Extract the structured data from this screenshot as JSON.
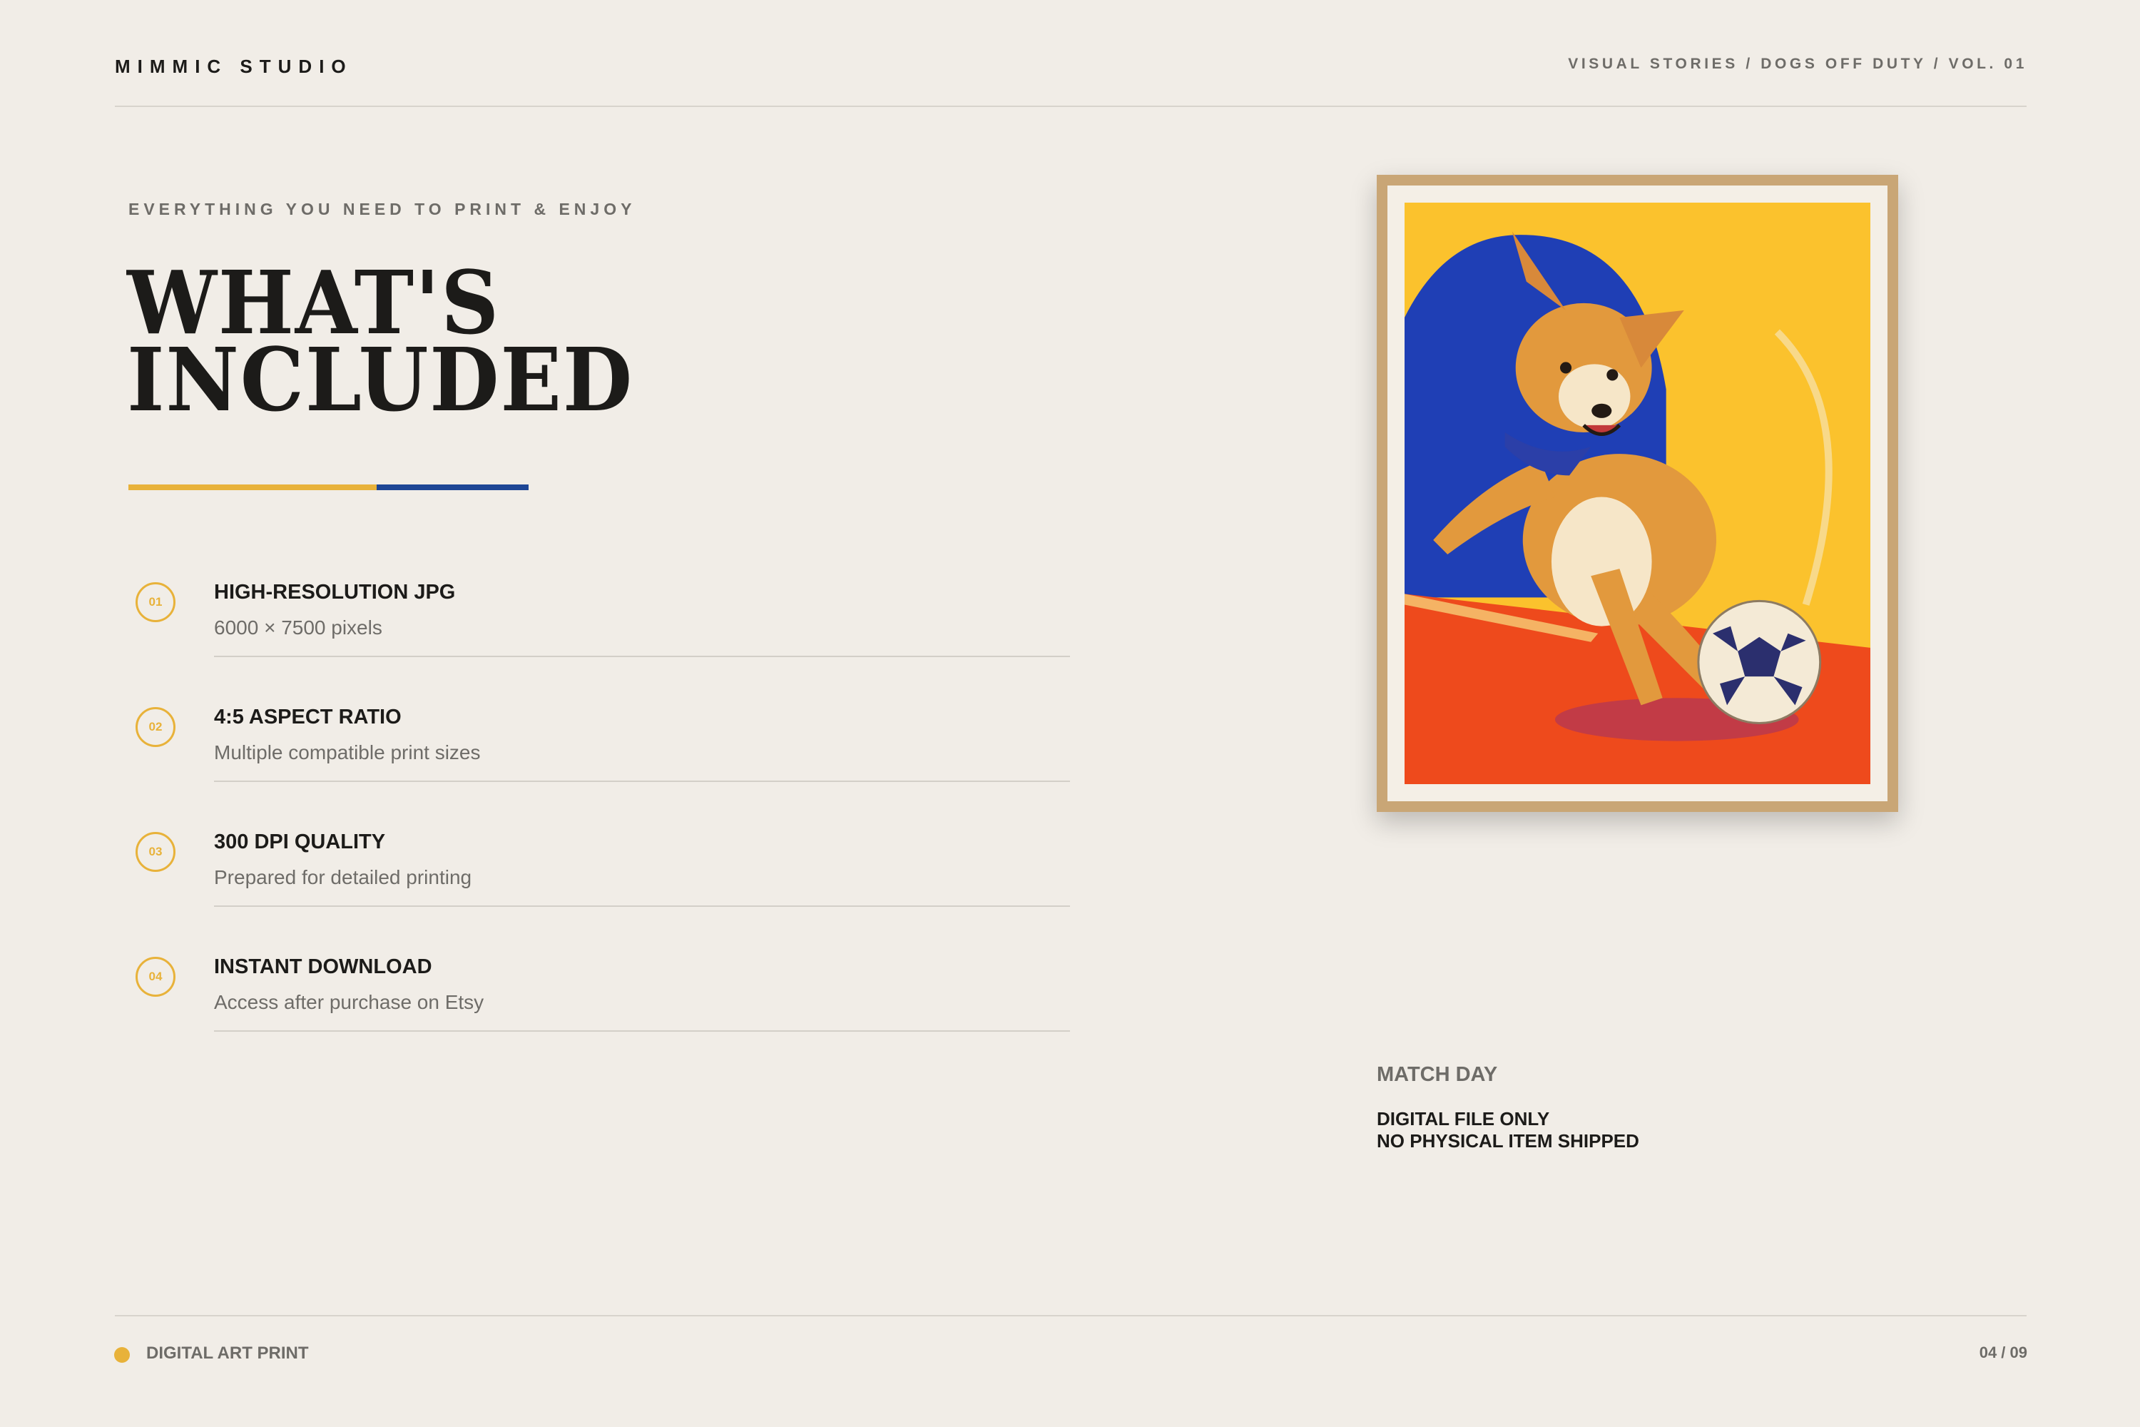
{
  "header": {
    "brand": "MIMMIC STUDIO",
    "breadcrumb": "VISUAL STORIES / DOGS OFF DUTY / VOL. 01"
  },
  "hero": {
    "eyebrow": "EVERYTHING YOU NEED TO PRINT & ENJOY",
    "title_line1": "WHAT'S",
    "title_line2": "INCLUDED"
  },
  "accent_colors": {
    "yellow": "#e8b23a",
    "blue": "#1e4695"
  },
  "features": [
    {
      "number": "01",
      "title": "HIGH-RESOLUTION JPG",
      "description": "6000 × 7500 pixels"
    },
    {
      "number": "02",
      "title": "4:5 ASPECT RATIO",
      "description": "Multiple compatible print sizes"
    },
    {
      "number": "03",
      "title": "300 DPI QUALITY",
      "description": "Prepared for detailed printing"
    },
    {
      "number": "04",
      "title": "INSTANT DOWNLOAD",
      "description": "Access after purchase on Etsy"
    }
  ],
  "artwork": {
    "subject": "corgi-kicking-soccer-ball-illustration",
    "palette": {
      "sky": "#fbc22d",
      "arch": "#1f3fb5",
      "floor": "#ee4a1c",
      "frame": "#c9a676"
    }
  },
  "caption": {
    "title": "MATCH DAY",
    "note_line1": "DIGITAL FILE ONLY",
    "note_line2": "NO PHYSICAL ITEM SHIPPED"
  },
  "footer": {
    "label": "DIGITAL ART PRINT",
    "page": "04 / 09"
  }
}
